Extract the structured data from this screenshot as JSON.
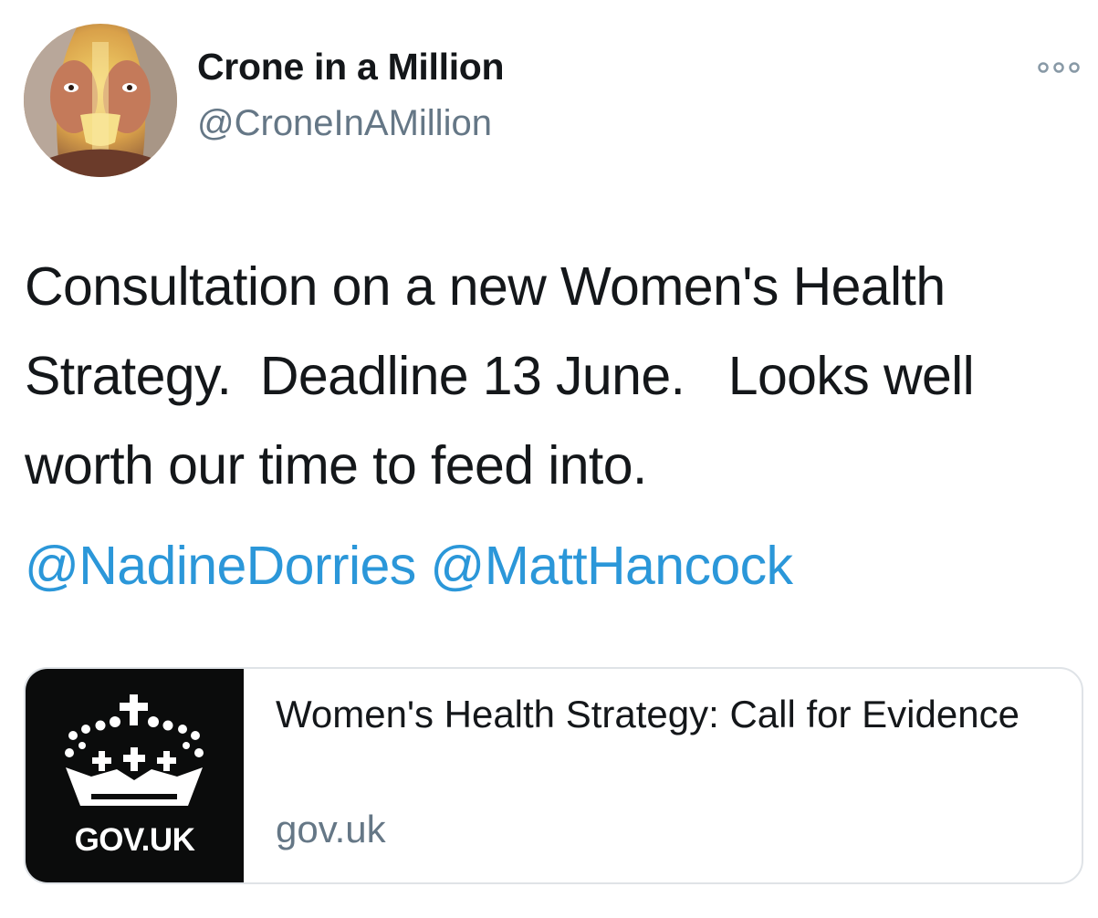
{
  "tweet": {
    "author": {
      "display_name": "Crone in a Million",
      "handle": "@CroneInAMillion",
      "avatar_icon": "profile-avatar"
    },
    "more_icon": "more-horizontal-icon",
    "text_lines": [
      "Consultation on a new Women's Health",
      "Strategy.  Deadline 13 June.   Looks well",
      "worth our time to feed into."
    ],
    "mentions": [
      "@NadineDorries",
      "@MattHancock"
    ],
    "card": {
      "image_logo_text": "GOV.UK",
      "image_icon": "govuk-crown-logo",
      "title": "Women's Health Strategy: Call for Evidence",
      "domain": "gov.uk"
    }
  },
  "colors": {
    "text": "#14171a",
    "secondary": "#657786",
    "link": "#2b97d9",
    "card_border": "#dfe3e7",
    "govuk_black": "#0b0c0c"
  }
}
